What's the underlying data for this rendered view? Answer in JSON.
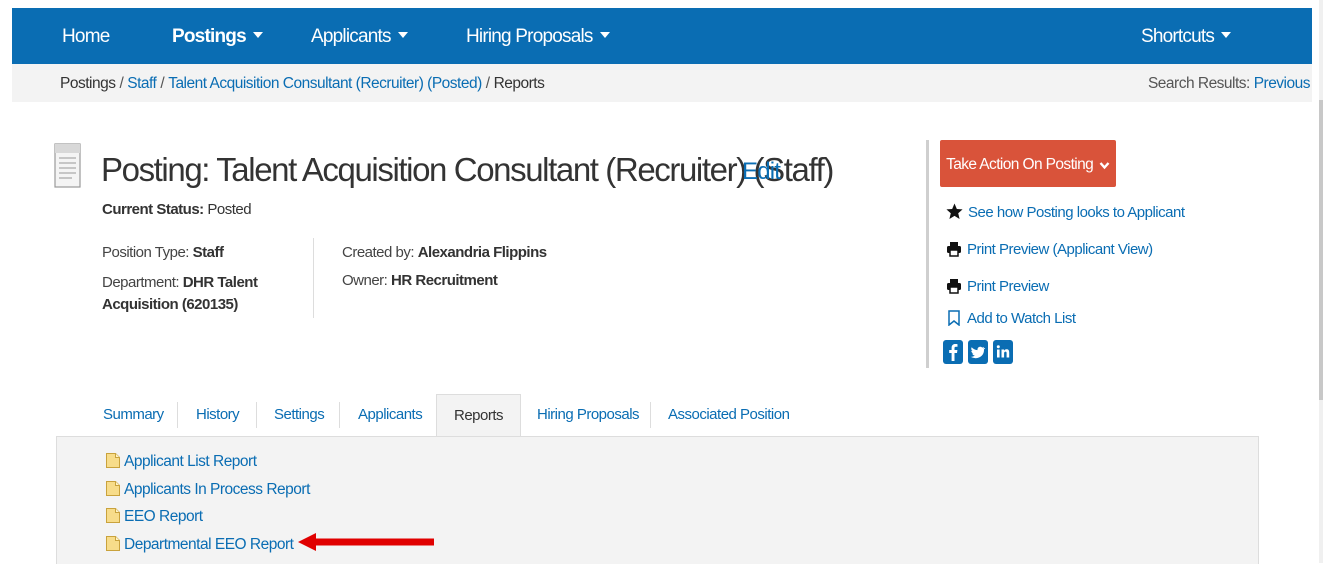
{
  "nav": {
    "home": "Home",
    "postings": "Postings",
    "applicants": "Applicants",
    "hiring_proposals": "Hiring Proposals",
    "shortcuts": "Shortcuts"
  },
  "breadcrumb": {
    "postings": "Postings",
    "staff": "Staff",
    "posting": "Talent Acquisition Consultant (Recruiter) (Posted)",
    "reports": "Reports"
  },
  "search_results": {
    "label": "Search Results:",
    "previous": "Previous"
  },
  "posting": {
    "title": "Posting: Talent Acquisition Consultant (Recruiter) (Staff)",
    "edit": "Edit",
    "status_label": "Current Status:",
    "status_value": "Posted",
    "position_type_label": "Position Type:",
    "position_type_value": "Staff",
    "department_label": "Department:",
    "department_value_1": "DHR Talent",
    "department_value_2": "Acquisition (620135)",
    "created_by_label": "Created by:",
    "created_by_value": "Alexandria Flippins",
    "owner_label": "Owner:",
    "owner_value": "HR Recruitment"
  },
  "sidebar": {
    "action_button": "Take Action On Posting",
    "see_how": "See how Posting looks to Applicant",
    "print_preview_applicant": "Print Preview (Applicant View)",
    "print_preview": "Print Preview",
    "watch_list": "Add to Watch List"
  },
  "tabs": [
    {
      "label": "Summary"
    },
    {
      "label": "History"
    },
    {
      "label": "Settings"
    },
    {
      "label": "Applicants"
    },
    {
      "label": "Reports"
    },
    {
      "label": "Hiring Proposals"
    },
    {
      "label": "Associated Position"
    }
  ],
  "active_tab": "Reports",
  "reports": [
    {
      "label": "Applicant List Report"
    },
    {
      "label": "Applicants In Process Report"
    },
    {
      "label": "EEO Report"
    },
    {
      "label": "Departmental EEO Report"
    }
  ],
  "colors": {
    "nav_bg": "#0a6db3",
    "link": "#0a6db3",
    "action_button": "#d9533a",
    "highlight_arrow": "#e00000",
    "panel_bg": "#f3f3f3"
  },
  "icons": {
    "doc": "document-icon",
    "star": "star-icon",
    "print": "printer-icon",
    "bookmark": "bookmark-icon",
    "facebook": "facebook-icon",
    "twitter": "twitter-icon",
    "linkedin": "linkedin-icon",
    "report": "note-icon",
    "arrow": "arrow-left-icon"
  }
}
